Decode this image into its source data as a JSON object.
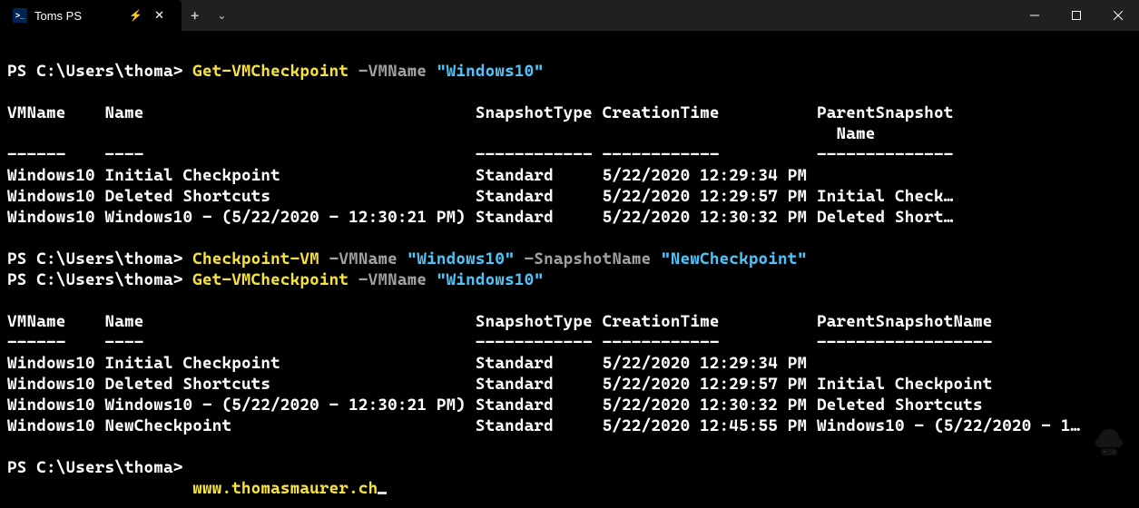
{
  "titlebar": {
    "tab_title": "Toms PS",
    "bolt": "⚡"
  },
  "prompt": "PS C:\\Users\\thoma>",
  "commands": {
    "cmd1": {
      "cmdlet": "Get-VMCheckpoint",
      "param": "-VMName",
      "arg": "\"Windows10\""
    },
    "cmd2": {
      "cmdlet": "Checkpoint-VM",
      "param1": "-VMName",
      "arg1": "\"Windows10\"",
      "param2": "-SnapshotName",
      "arg2": "\"NewCheckpoint\""
    },
    "cmd3": {
      "cmdlet": "Get-VMCheckpoint",
      "param": "-VMName",
      "arg": "\"Windows10\""
    }
  },
  "table1": {
    "header": {
      "vmname": "VMName",
      "name": "Name",
      "snapshot": "SnapshotType",
      "creation": "CreationTime",
      "parent1": "ParentSnapshot",
      "parent2": "Name"
    },
    "dashes": {
      "vmname": "------",
      "name": "----",
      "snapshot": "------------",
      "creation": "------------",
      "parent": "--------------"
    },
    "rows": {
      "r0": {
        "vmname": "Windows10",
        "name": "Initial Checkpoint",
        "snapshot": "Standard",
        "creation": "5/22/2020 12:29:34 PM",
        "parent": ""
      },
      "r1": {
        "vmname": "Windows10",
        "name": "Deleted Shortcuts",
        "snapshot": "Standard",
        "creation": "5/22/2020 12:29:57 PM",
        "parent": "Initial Check…"
      },
      "r2": {
        "vmname": "Windows10",
        "name": "Windows10 - (5/22/2020 - 12:30:21 PM)",
        "snapshot": "Standard",
        "creation": "5/22/2020 12:30:32 PM",
        "parent": "Deleted Short…"
      }
    }
  },
  "table2": {
    "header": {
      "vmname": "VMName",
      "name": "Name",
      "snapshot": "SnapshotType",
      "creation": "CreationTime",
      "parent": "ParentSnapshotName"
    },
    "dashes": {
      "vmname": "------",
      "name": "----",
      "snapshot": "------------",
      "creation": "------------",
      "parent": "------------------"
    },
    "rows": {
      "r0": {
        "vmname": "Windows10",
        "name": "Initial Checkpoint",
        "snapshot": "Standard",
        "creation": "5/22/2020 12:29:34 PM",
        "parent": ""
      },
      "r1": {
        "vmname": "Windows10",
        "name": "Deleted Shortcuts",
        "snapshot": "Standard",
        "creation": "5/22/2020 12:29:57 PM",
        "parent": "Initial Checkpoint"
      },
      "r2": {
        "vmname": "Windows10",
        "name": "Windows10 - (5/22/2020 - 12:30:21 PM)",
        "snapshot": "Standard",
        "creation": "5/22/2020 12:30:32 PM",
        "parent": "Deleted Shortcuts"
      },
      "r3": {
        "vmname": "Windows10",
        "name": "NewCheckpoint",
        "snapshot": "Standard",
        "creation": "5/22/2020 12:45:55 PM",
        "parent": "Windows10 - (5/22/2020 - 1…"
      }
    }
  },
  "footer_url": "www.thomasmaurer.ch"
}
